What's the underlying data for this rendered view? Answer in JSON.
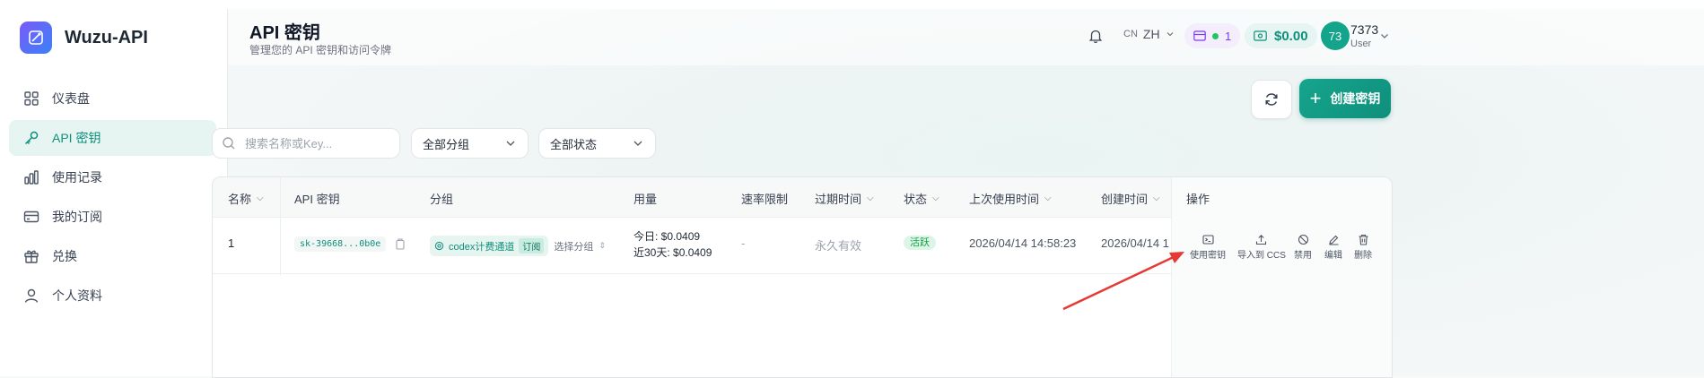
{
  "app": {
    "name": "Wuzu-API"
  },
  "sidebar": {
    "items": [
      {
        "label": "仪表盘",
        "icon": "dashboard-icon",
        "active": false
      },
      {
        "label": "API 密钥",
        "icon": "key-icon",
        "active": true
      },
      {
        "label": "使用记录",
        "icon": "bar-chart-icon",
        "active": false
      },
      {
        "label": "我的订阅",
        "icon": "credit-card-icon",
        "active": false
      },
      {
        "label": "兑换",
        "icon": "gift-icon",
        "active": false
      },
      {
        "label": "个人资料",
        "icon": "user-icon",
        "active": false
      }
    ]
  },
  "header": {
    "title": "API 密钥",
    "subtitle": "管理您的 API 密钥和访问令牌",
    "lang_prefix": "CN",
    "lang": "ZH",
    "subscription_count": "1",
    "balance": "$0.00",
    "user": {
      "avatar": "73",
      "name": "7373",
      "role": "User"
    }
  },
  "actions": {
    "create_label": "创建密钥"
  },
  "filters": {
    "search_placeholder": "搜索名称或Key...",
    "group_select": "全部分组",
    "status_select": "全部状态"
  },
  "table": {
    "columns": {
      "name": "名称",
      "key": "API 密钥",
      "group": "分组",
      "usage": "用量",
      "rate": "速率限制",
      "expiry": "过期时间",
      "status": "状态",
      "last_used": "上次使用时间",
      "created": "创建时间",
      "ops": "操作"
    },
    "rows": [
      {
        "name": "1",
        "key": "sk-39668...0b0e",
        "group": "codex计费通道",
        "group_badge": "订阅",
        "group_action": "选择分组",
        "usage_today": "今日: $0.0409",
        "usage_30d": "近30天: $0.0409",
        "rate": "-",
        "expiry": "永久有效",
        "status": "活跃",
        "last_used": "2026/04/14 14:58:23",
        "created": "2026/04/14 1"
      }
    ],
    "row_actions": [
      "使用密钥",
      "导入到 CCS",
      "禁用",
      "编辑",
      "删除"
    ]
  },
  "colors": {
    "accent": "#0f8f7c",
    "annotation_arrow": "#e53935"
  }
}
